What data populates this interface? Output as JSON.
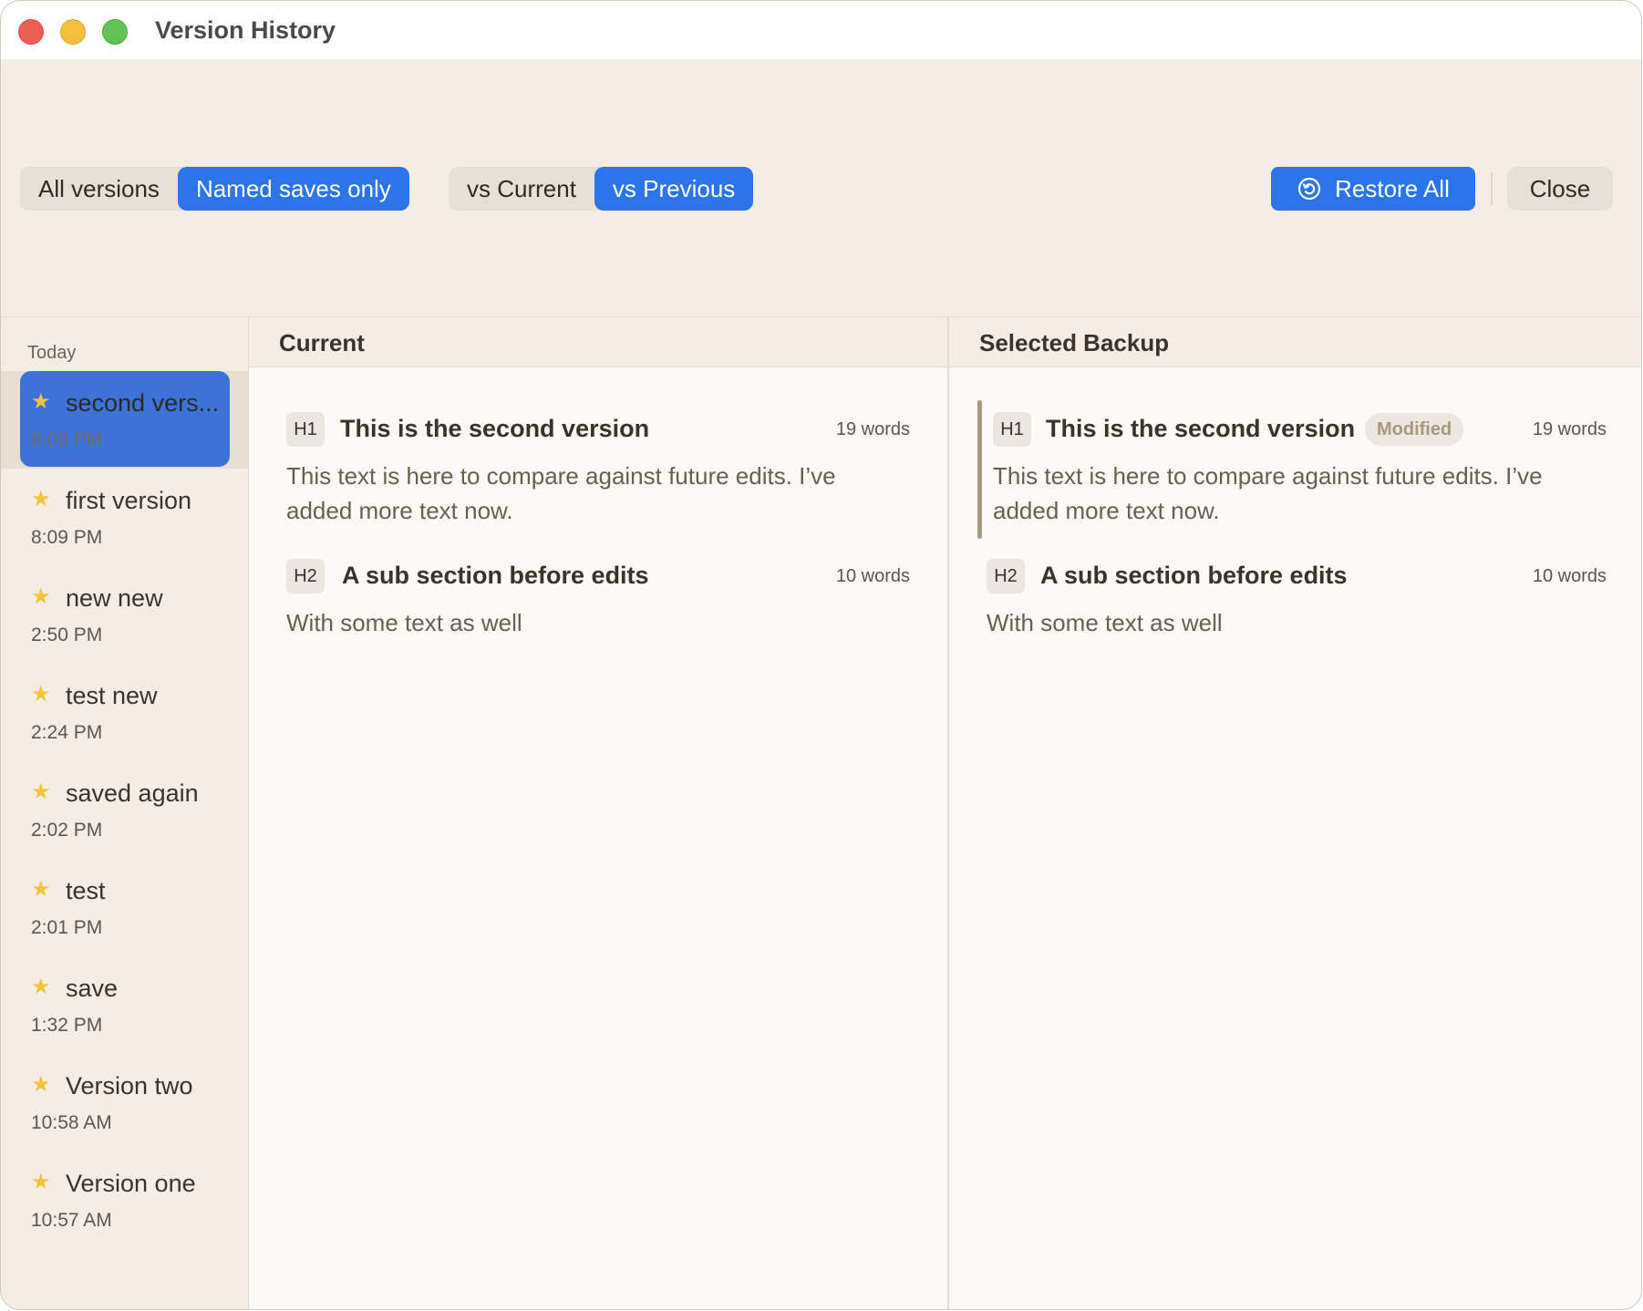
{
  "window": {
    "title": "Version History"
  },
  "toolbar": {
    "filter": {
      "all": "All versions",
      "named": "Named saves only",
      "selected": "named"
    },
    "compare": {
      "current": "vs Current",
      "previous": "vs Previous",
      "selected": "previous"
    },
    "restore_label": "Restore All",
    "close_label": "Close"
  },
  "sidebar": {
    "group_label": "Today",
    "items": [
      {
        "name": "second vers...",
        "time": "8:09 PM",
        "selected": true
      },
      {
        "name": "first version",
        "time": "8:09 PM"
      },
      {
        "name": "new new",
        "time": "2:50 PM"
      },
      {
        "name": "test new",
        "time": "2:24 PM"
      },
      {
        "name": "saved again",
        "time": "2:02 PM"
      },
      {
        "name": "test",
        "time": "2:01 PM"
      },
      {
        "name": "save",
        "time": "1:32 PM"
      },
      {
        "name": "Version two",
        "time": "10:58 AM"
      },
      {
        "name": "Version one",
        "time": "10:57 AM"
      }
    ]
  },
  "current": {
    "header": "Current",
    "sections": [
      {
        "level": "H1",
        "title": "This is the second version",
        "words": "19 words",
        "text": "This text is here to compare against future edits. I’ve added more text now."
      },
      {
        "level": "H2",
        "title": "A sub section before edits",
        "words": "10 words",
        "text": "With some text as well"
      }
    ]
  },
  "backup": {
    "header": "Selected Backup",
    "sections": [
      {
        "level": "H1",
        "title": "This is the second version",
        "badge": "Modified",
        "words": "19 words",
        "text": "This text is here to compare against future edits. I’ve added more text now."
      },
      {
        "level": "H2",
        "title": "A sub section before edits",
        "words": "10 words",
        "text": "With some text as well"
      }
    ]
  },
  "icons": {
    "star": "star-icon",
    "restore": "restore-icon"
  },
  "colors": {
    "accent": "#2b74ea",
    "selected_item": "#3d73d6",
    "star": "#f4c23b"
  }
}
